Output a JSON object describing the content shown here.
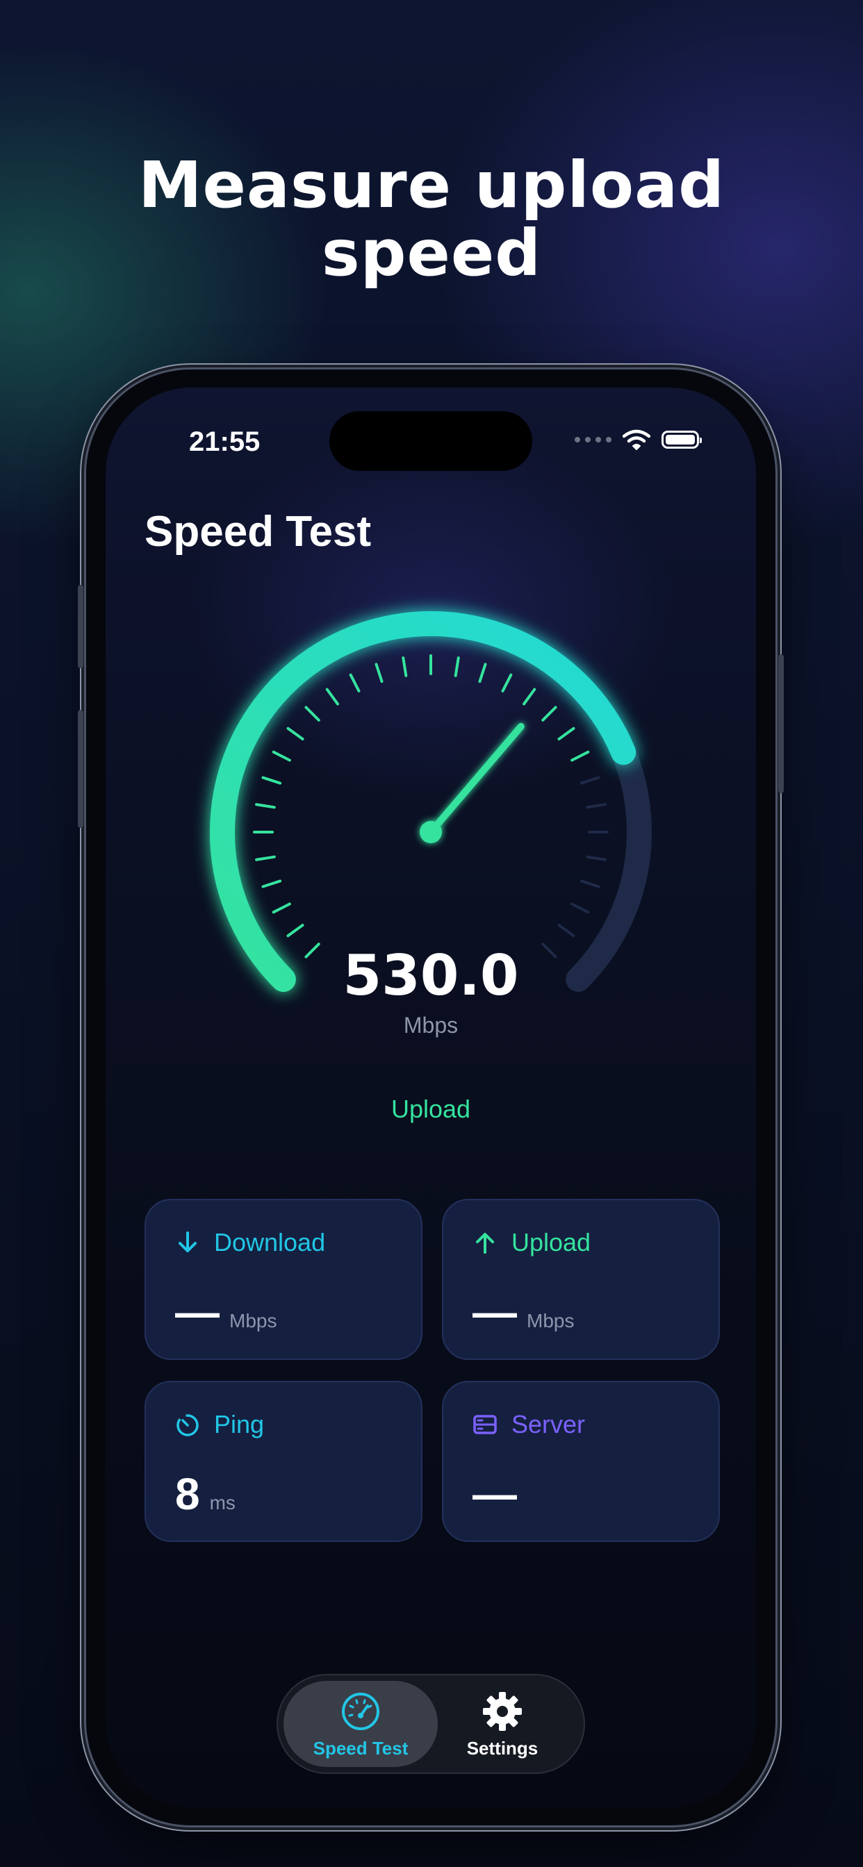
{
  "headline": {
    "line1": "Measure upload",
    "line2": "speed"
  },
  "status_bar": {
    "time": "21:55",
    "signal_icon": "cellular-dots-icon",
    "wifi_icon": "wifi-icon",
    "battery_icon": "battery-icon"
  },
  "screen_title": "Speed Test",
  "gauge": {
    "value": "530.0",
    "unit": "Mbps",
    "mode_label": "Upload",
    "progress_fraction": 0.75,
    "accent_start": "#35e39e",
    "accent_end": "#22d9d6",
    "track_color": "#1e2a47"
  },
  "cards": {
    "download": {
      "label": "Download",
      "value": "—",
      "unit": "Mbps",
      "icon": "arrow-down-icon",
      "color": "#22c6e6"
    },
    "upload": {
      "label": "Upload",
      "value": "—",
      "unit": "Mbps",
      "icon": "arrow-up-icon",
      "color": "#35e39e"
    },
    "ping": {
      "label": "Ping",
      "value": "8",
      "unit": "ms",
      "icon": "timer-icon",
      "color": "#22c6e6"
    },
    "server": {
      "label": "Server",
      "value": "—",
      "icon": "server-icon",
      "color": "#7b61ff"
    }
  },
  "tabs": [
    {
      "label": "Speed Test",
      "icon": "speedometer-icon",
      "active": true,
      "color": "#22c6e6"
    },
    {
      "label": "Settings",
      "icon": "gear-icon",
      "active": false,
      "color": "#ffffff"
    }
  ]
}
